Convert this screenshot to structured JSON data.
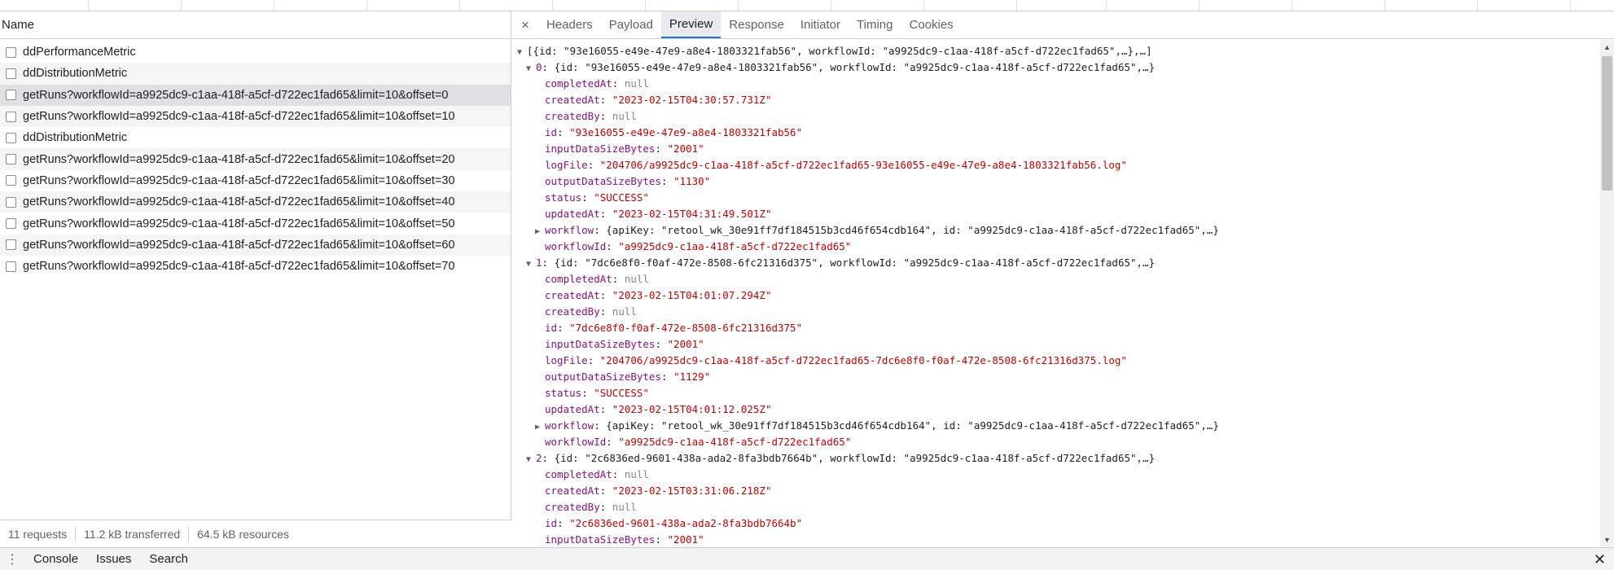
{
  "request_list": {
    "column_header": "Name",
    "rows": [
      "ddPerformanceMetric",
      "ddDistributionMetric",
      "getRuns?workflowId=a9925dc9-c1aa-418f-a5cf-d722ec1fad65&limit=10&offset=0",
      "getRuns?workflowId=a9925dc9-c1aa-418f-a5cf-d722ec1fad65&limit=10&offset=10",
      "ddDistributionMetric",
      "getRuns?workflowId=a9925dc9-c1aa-418f-a5cf-d722ec1fad65&limit=10&offset=20",
      "getRuns?workflowId=a9925dc9-c1aa-418f-a5cf-d722ec1fad65&limit=10&offset=30",
      "getRuns?workflowId=a9925dc9-c1aa-418f-a5cf-d722ec1fad65&limit=10&offset=40",
      "getRuns?workflowId=a9925dc9-c1aa-418f-a5cf-d722ec1fad65&limit=10&offset=50",
      "getRuns?workflowId=a9925dc9-c1aa-418f-a5cf-d722ec1fad65&limit=10&offset=60",
      "getRuns?workflowId=a9925dc9-c1aa-418f-a5cf-d722ec1fad65&limit=10&offset=70"
    ],
    "selected_index": 2
  },
  "summary": {
    "requests": "11 requests",
    "transferred": "11.2 kB transferred",
    "resources": "64.5 kB resources"
  },
  "detail_tabs": {
    "close_glyph": "×",
    "items": [
      "Headers",
      "Payload",
      "Preview",
      "Response",
      "Initiator",
      "Timing",
      "Cookies"
    ],
    "active": "Preview"
  },
  "preview": {
    "root_summary": "[{id: \"93e16055-e49e-47e9-a8e4-1803321fab56\", workflowId: \"a9925dc9-c1aa-418f-a5cf-d722ec1fad65\",…},…]",
    "items": [
      {
        "index": "0",
        "summary": "{id: \"93e16055-e49e-47e9-a8e4-1803321fab56\", workflowId: \"a9925dc9-c1aa-418f-a5cf-d722ec1fad65\",…}",
        "fields": [
          {
            "key": "completedAt",
            "value": "null",
            "kind": "null"
          },
          {
            "key": "createdAt",
            "value": "\"2023-02-15T04:30:57.731Z\"",
            "kind": "string"
          },
          {
            "key": "createdBy",
            "value": "null",
            "kind": "null"
          },
          {
            "key": "id",
            "value": "\"93e16055-e49e-47e9-a8e4-1803321fab56\"",
            "kind": "string"
          },
          {
            "key": "inputDataSizeBytes",
            "value": "\"2001\"",
            "kind": "string"
          },
          {
            "key": "logFile",
            "value": "\"204706/a9925dc9-c1aa-418f-a5cf-d722ec1fad65-93e16055-e49e-47e9-a8e4-1803321fab56.log\"",
            "kind": "string"
          },
          {
            "key": "outputDataSizeBytes",
            "value": "\"1130\"",
            "kind": "string"
          },
          {
            "key": "status",
            "value": "\"SUCCESS\"",
            "kind": "string"
          },
          {
            "key": "updatedAt",
            "value": "\"2023-02-15T04:31:49.501Z\"",
            "kind": "string"
          },
          {
            "key": "workflow",
            "value": "{apiKey: \"retool_wk_30e91ff7df184515b3cd46f654cdb164\", id: \"a9925dc9-c1aa-418f-a5cf-d722ec1fad65\",…}",
            "kind": "object"
          },
          {
            "key": "workflowId",
            "value": "\"a9925dc9-c1aa-418f-a5cf-d722ec1fad65\"",
            "kind": "string"
          }
        ]
      },
      {
        "index": "1",
        "summary": "{id: \"7dc6e8f0-f0af-472e-8508-6fc21316d375\", workflowId: \"a9925dc9-c1aa-418f-a5cf-d722ec1fad65\",…}",
        "fields": [
          {
            "key": "completedAt",
            "value": "null",
            "kind": "null"
          },
          {
            "key": "createdAt",
            "value": "\"2023-02-15T04:01:07.294Z\"",
            "kind": "string"
          },
          {
            "key": "createdBy",
            "value": "null",
            "kind": "null"
          },
          {
            "key": "id",
            "value": "\"7dc6e8f0-f0af-472e-8508-6fc21316d375\"",
            "kind": "string"
          },
          {
            "key": "inputDataSizeBytes",
            "value": "\"2001\"",
            "kind": "string"
          },
          {
            "key": "logFile",
            "value": "\"204706/a9925dc9-c1aa-418f-a5cf-d722ec1fad65-7dc6e8f0-f0af-472e-8508-6fc21316d375.log\"",
            "kind": "string"
          },
          {
            "key": "outputDataSizeBytes",
            "value": "\"1129\"",
            "kind": "string"
          },
          {
            "key": "status",
            "value": "\"SUCCESS\"",
            "kind": "string"
          },
          {
            "key": "updatedAt",
            "value": "\"2023-02-15T04:01:12.025Z\"",
            "kind": "string"
          },
          {
            "key": "workflow",
            "value": "{apiKey: \"retool_wk_30e91ff7df184515b3cd46f654cdb164\", id: \"a9925dc9-c1aa-418f-a5cf-d722ec1fad65\",…}",
            "kind": "object"
          },
          {
            "key": "workflowId",
            "value": "\"a9925dc9-c1aa-418f-a5cf-d722ec1fad65\"",
            "kind": "string"
          }
        ]
      },
      {
        "index": "2",
        "summary": "{id: \"2c6836ed-9601-438a-ada2-8fa3bdb7664b\", workflowId: \"a9925dc9-c1aa-418f-a5cf-d722ec1fad65\",…}",
        "fields": [
          {
            "key": "completedAt",
            "value": "null",
            "kind": "null"
          },
          {
            "key": "createdAt",
            "value": "\"2023-02-15T03:31:06.218Z\"",
            "kind": "string"
          },
          {
            "key": "createdBy",
            "value": "null",
            "kind": "null"
          },
          {
            "key": "id",
            "value": "\"2c6836ed-9601-438a-ada2-8fa3bdb7664b\"",
            "kind": "string"
          },
          {
            "key": "inputDataSizeBytes",
            "value": "\"2001\"",
            "kind": "string"
          }
        ]
      }
    ]
  },
  "drawer": {
    "menu_glyph": "⋮",
    "tabs": [
      "Console",
      "Issues",
      "Search"
    ],
    "close_glyph": "✕"
  },
  "icons": {
    "checkbox": "checkbox-icon",
    "expand_open": "▼",
    "expand_closed": "▶",
    "scroll_up": "▲",
    "scroll_down": "▼"
  },
  "colors": {
    "accent": "#1a73e8",
    "json_key": "#881280",
    "json_string": "#c80000",
    "json_null": "#80868b",
    "selected_row": "#dee0e3"
  }
}
